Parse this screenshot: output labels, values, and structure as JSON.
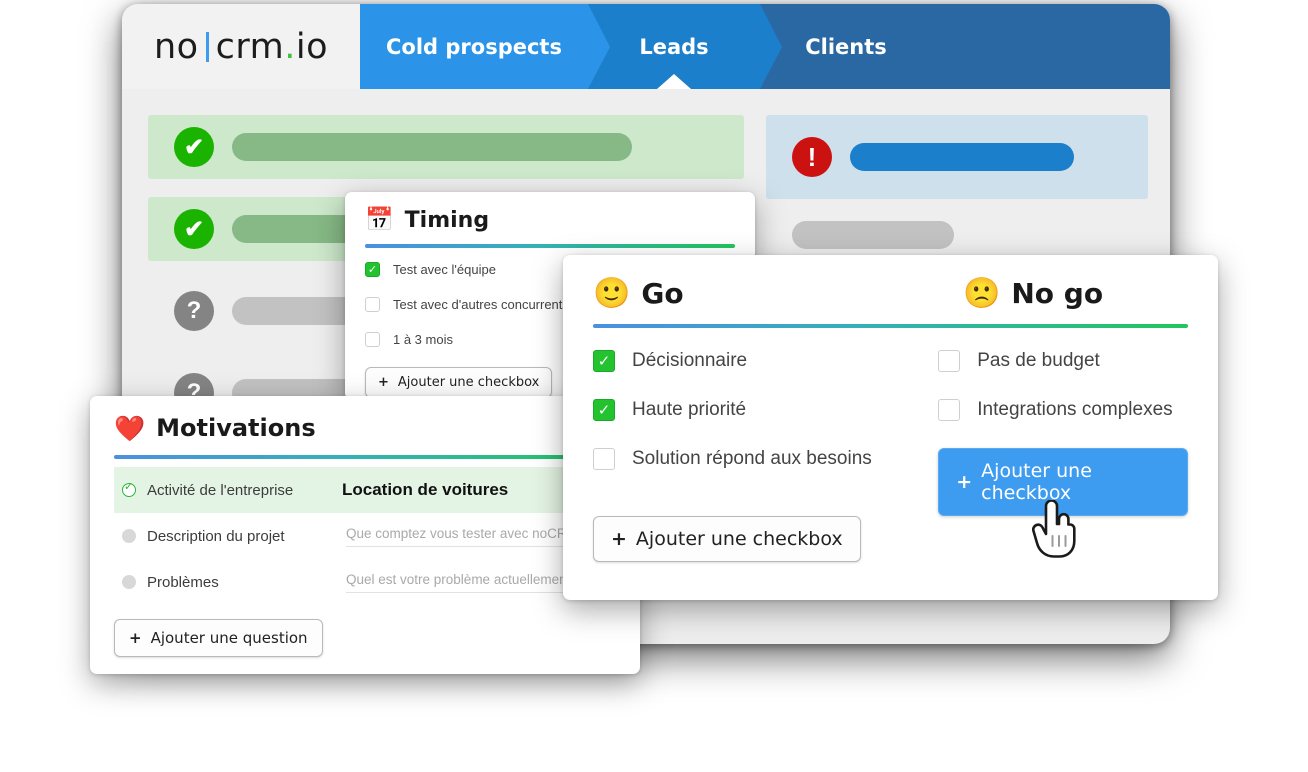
{
  "app": {
    "logo": {
      "part1": "no",
      "part2": "crm",
      "dot": ".",
      "part3": "io"
    },
    "tabs": [
      {
        "label": "Cold prospects",
        "color": "#2b94e8"
      },
      {
        "label": "Leads",
        "color": "#1b7fcc",
        "active": true
      },
      {
        "label": "Clients",
        "color": "#2a68a4"
      }
    ],
    "background_rows": [
      {
        "icon": "check-circle-icon",
        "glyph": "✔",
        "state": "ok"
      },
      {
        "icon": "check-circle-icon",
        "glyph": "✔",
        "state": "ok"
      },
      {
        "icon": "question-circle-icon",
        "glyph": "?",
        "state": "unknown"
      },
      {
        "icon": "question-circle-icon",
        "glyph": "?",
        "state": "unknown"
      }
    ],
    "alert_row": {
      "icon": "alert-circle-icon",
      "glyph": "!"
    }
  },
  "timing_panel": {
    "emoji": "📅",
    "emoji_name": "calendar-icon",
    "title": "Timing",
    "items": [
      {
        "label": "Test avec l'équipe",
        "checked": true
      },
      {
        "label": "Test avec d'autres concurrents",
        "checked": false
      },
      {
        "label": "1 à 3 mois",
        "checked": false
      }
    ],
    "add_button": "Ajouter une checkbox",
    "plus": "+"
  },
  "go_panel": {
    "go": {
      "emoji": "🙂",
      "emoji_name": "slightly-smiling-face-icon",
      "title": "Go",
      "items": [
        {
          "label": "Décisionnaire",
          "checked": true
        },
        {
          "label": "Haute priorité",
          "checked": true
        },
        {
          "label": "Solution répond aux besoins",
          "checked": false
        }
      ],
      "add_button": "Ajouter une checkbox"
    },
    "no_go": {
      "emoji": "🙁",
      "emoji_name": "frowning-face-icon",
      "title": "No go",
      "items": [
        {
          "label": "Pas de budget",
          "checked": false
        },
        {
          "label": "Integrations complexes",
          "checked": false
        }
      ],
      "add_button": "Ajouter une checkbox"
    },
    "plus": "+",
    "primary_color": "#3d9bf0"
  },
  "motivations_panel": {
    "emoji": "❤️",
    "emoji_name": "red-heart-icon",
    "title": "Motivations",
    "fields": [
      {
        "label": "Activité de l'entreprise",
        "value": "Location de voitures",
        "filled": true
      },
      {
        "label": "Description du projet",
        "placeholder": "Que comptez vous tester avec noCRM ?",
        "filled": false
      },
      {
        "label": "Problèmes",
        "placeholder": "Quel est votre problème actuellement ?",
        "filled": false
      }
    ],
    "add_button": "Ajouter une question",
    "plus": "+"
  },
  "cursor": {
    "name": "pointing-hand-cursor"
  }
}
